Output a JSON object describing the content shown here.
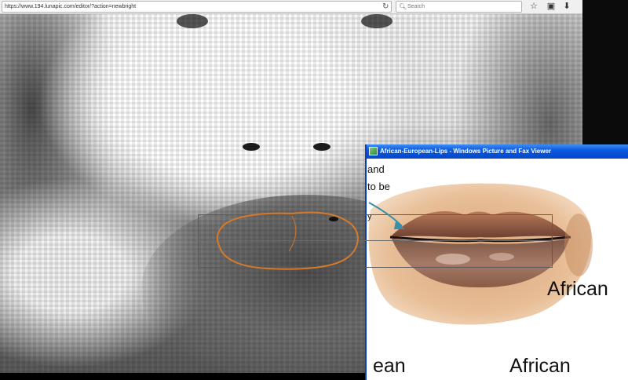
{
  "browser": {
    "url": "https://www.194.lunapic.com/editor/?action=newbright",
    "search_placeholder": "Search",
    "icons": {
      "reload": "reload-icon",
      "search": "search-icon",
      "bookmark": "star-icon",
      "library": "library-icon",
      "downloads": "download-arrow-icon"
    }
  },
  "viewer": {
    "title": "African-European-Lips - Windows Picture and Fax Viewer",
    "text_and": "and",
    "text_to_be": "to be",
    "text_y": "y",
    "text_african_1": "African",
    "text_ean": "ean",
    "text_african_2": "African"
  },
  "colors": {
    "titlebar_blue": "#0a5ae0",
    "lasso_orange": "#d47a2a",
    "arrow_teal": "#3a8fa8",
    "lip_brown": "#8a5a40"
  }
}
